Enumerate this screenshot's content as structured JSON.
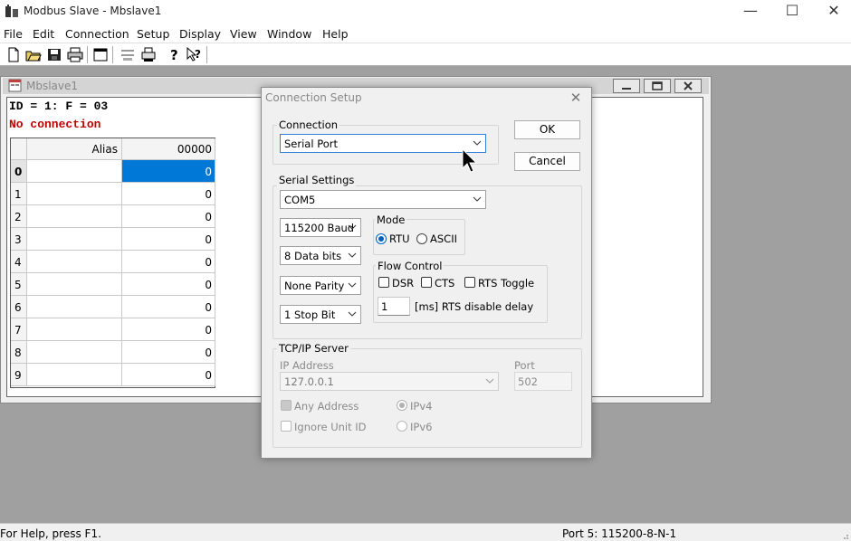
{
  "window": {
    "title": "Modbus Slave - Mbslave1",
    "minimize": "—",
    "maximize": "☐",
    "close": "✕"
  },
  "menu": [
    "File",
    "Edit",
    "Connection",
    "Setup",
    "Display",
    "View",
    "Window",
    "Help"
  ],
  "toolbar": {
    "icons": [
      "new-file-icon",
      "open-folder-icon",
      "save-icon",
      "print-icon",
      "window-icon",
      "comm-icon",
      "printer-icon",
      "help-icon",
      "context-help-icon"
    ]
  },
  "child": {
    "title": "Mbslave1",
    "id_line": "ID = 1: F = 03",
    "status_line": "No connection",
    "status_color": "#c00000",
    "grid": {
      "headers": [
        "Alias",
        "00000"
      ],
      "rows": [
        {
          "index": "0",
          "alias": "",
          "value": "0"
        },
        {
          "index": "1",
          "alias": "",
          "value": "0"
        },
        {
          "index": "2",
          "alias": "",
          "value": "0"
        },
        {
          "index": "3",
          "alias": "",
          "value": "0"
        },
        {
          "index": "4",
          "alias": "",
          "value": "0"
        },
        {
          "index": "5",
          "alias": "",
          "value": "0"
        },
        {
          "index": "6",
          "alias": "",
          "value": "0"
        },
        {
          "index": "7",
          "alias": "",
          "value": "0"
        },
        {
          "index": "8",
          "alias": "",
          "value": "0"
        },
        {
          "index": "9",
          "alias": "",
          "value": "0"
        }
      ],
      "selected_color": "#0078d7"
    }
  },
  "dialog": {
    "title": "Connection Setup",
    "close": "✕",
    "ok_label": "OK",
    "cancel_label": "Cancel",
    "connection": {
      "label": "Connection",
      "value": "Serial Port"
    },
    "serial": {
      "label": "Serial Settings",
      "port": "COM5",
      "baud": "115200 Baud",
      "data_bits": "8 Data bits",
      "parity": "None Parity",
      "stop_bits": "1 Stop Bit",
      "mode": {
        "label": "Mode",
        "rtu": "RTU",
        "ascii": "ASCII",
        "selected": "RTU"
      },
      "flow": {
        "label": "Flow Control",
        "dsr": "DSR",
        "cts": "CTS",
        "rts_toggle": "RTS Toggle",
        "delay_value": "1",
        "delay_label": "[ms] RTS disable delay"
      }
    },
    "tcp": {
      "label": "TCP/IP Server",
      "ip_label": "IP Address",
      "ip_value": "127.0.0.1",
      "port_label": "Port",
      "port_value": "502",
      "any_address": "Any Address",
      "ignore_unit_id": "Ignore Unit ID",
      "ipv4": "IPv4",
      "ipv6": "IPv6"
    }
  },
  "status": {
    "help": "For Help, press F1.",
    "port": "Port 5: 115200-8-N-1"
  }
}
